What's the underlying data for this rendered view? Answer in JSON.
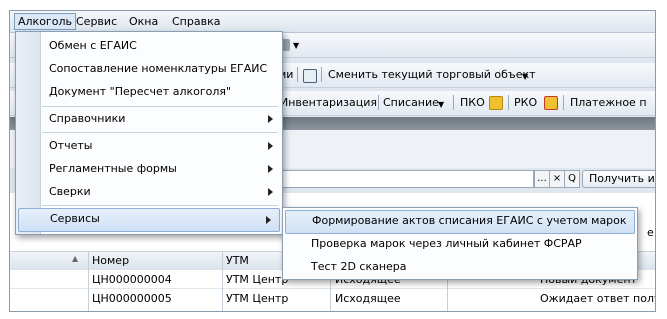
{
  "menubar": [
    {
      "label": "Алкоголь",
      "active": true
    },
    {
      "label": "Сервис"
    },
    {
      "label": "Окна"
    },
    {
      "label": "Справка"
    }
  ],
  "toolbar1": {
    "fragment": "ми",
    "change_object": "Сменить текущий торговый объект"
  },
  "toolbar2": {
    "inventory": "Инвентаризация",
    "writeoff": "Списание",
    "pko": "ПКО",
    "rko": "РКО",
    "payment": "Платежное п"
  },
  "search": {
    "dots": "...",
    "clear": "×",
    "find": "Q",
    "get_info": "Получить ин"
  },
  "table": {
    "headers": [
      "Номер",
      "УТМ"
    ],
    "rows": [
      {
        "number": "ЦН000000004",
        "utm": "УТМ Центр",
        "dir": "Исходящее",
        "status": "Новый документ"
      },
      {
        "number": "ЦН000000005",
        "utm": "УТМ Центр",
        "dir": "Исходящее",
        "status": "Ожидает ответ получ"
      }
    ],
    "right_fragment": "е"
  },
  "alco_menu": {
    "items": [
      {
        "label": "Обмен с ЕГАИС"
      },
      {
        "label": "Сопоставление номенклатуры ЕГАИС"
      },
      {
        "label": "Документ \"Пересчет алкоголя\""
      },
      {
        "label": "Справочники",
        "submenu": true
      },
      {
        "label": "Отчеты",
        "submenu": true
      },
      {
        "label": "Регламентные формы",
        "submenu": true
      },
      {
        "label": "Сверки",
        "submenu": true
      },
      {
        "label": "Сервисы",
        "submenu": true,
        "highlighted": true
      }
    ]
  },
  "services_menu": {
    "items": [
      {
        "label": "Формирование актов списания ЕГАИС с учетом марок",
        "highlighted": true
      },
      {
        "label": "Проверка марок через личный кабинет ФСРАР"
      },
      {
        "label": "Тест 2D сканера"
      }
    ]
  }
}
